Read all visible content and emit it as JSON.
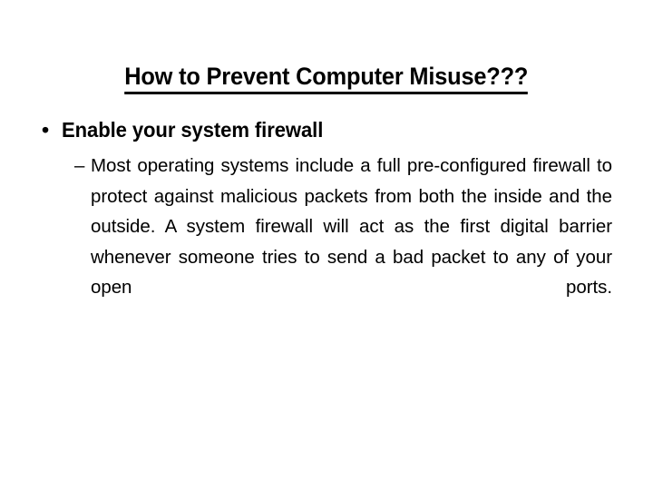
{
  "slide": {
    "background_color": "#ffffff",
    "text_color": "#000000",
    "title": "How to Prevent Computer Misuse???",
    "content": {
      "level1": {
        "marker": "•",
        "marker_name": "bullet-dot",
        "text": "Enable your system firewall"
      },
      "level2": {
        "marker": "–",
        "marker_name": "bullet-dash",
        "text": "Most operating systems include a full pre-configured firewall to protect against malicious packets from both the inside and the outside. A system firewall will act as the first digital barrier whenever someone tries to send a bad packet to any of your open ports.",
        "lines": [
          "Most operating systems include a full pre-",
          "configured firewall to protect against malicious",
          "packets from both the inside and the outside. A",
          "system firewall will act as the first digital barrier",
          "whenever someone tries to send a bad packet to",
          "any of your open ports."
        ]
      }
    }
  }
}
